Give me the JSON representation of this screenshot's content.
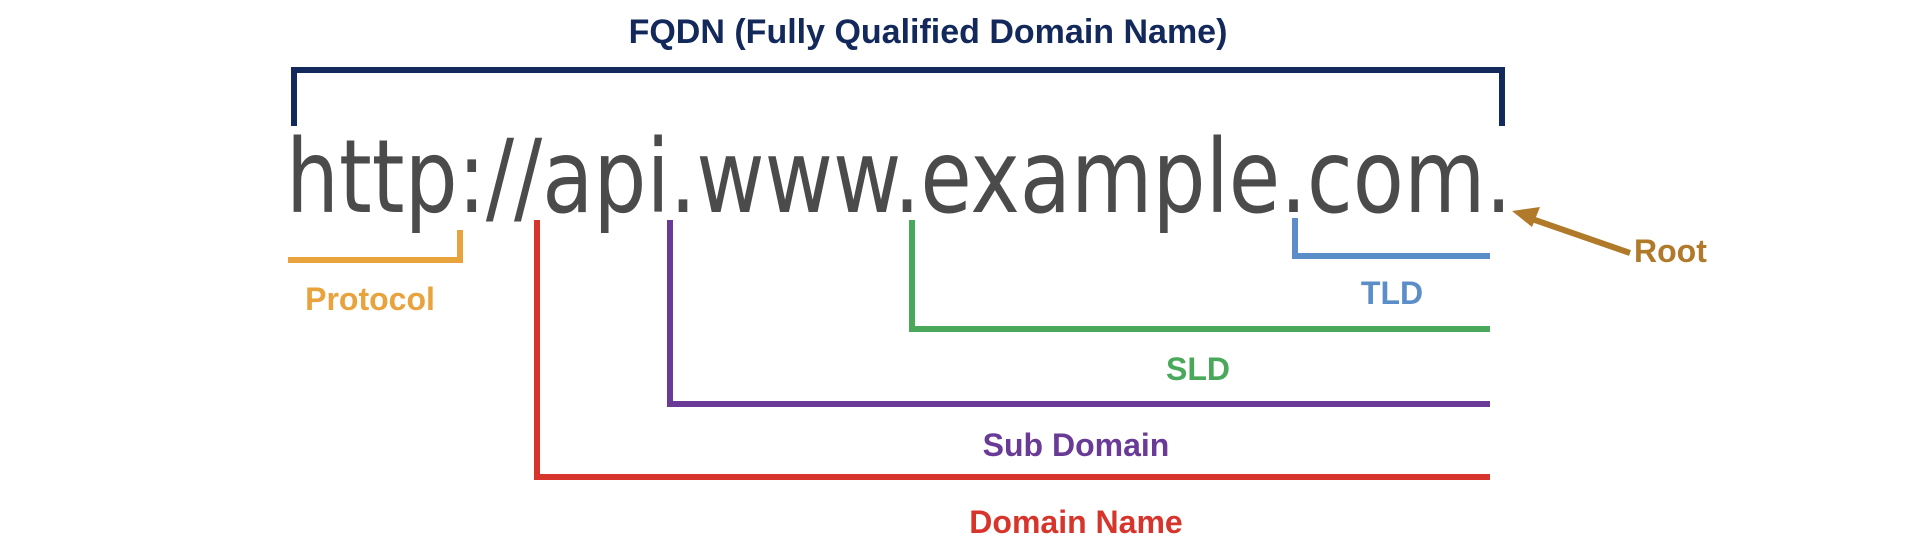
{
  "title": "FQDN (Fully Qualified Domain Name)",
  "url": {
    "protocol": "http:",
    "slashes": "//",
    "subdomain": "api.",
    "www": "www.",
    "sld": "example",
    "tld": ".com",
    "root": "."
  },
  "labels": {
    "protocol": "Protocol",
    "tld": "TLD",
    "sld": "SLD",
    "subdomain": "Sub Domain",
    "domain_name": "Domain Name",
    "root": "Root"
  },
  "colors": {
    "fqdn": "#13295b",
    "url_text": "#4b4b4b",
    "protocol": "#e8a33d",
    "tld": "#5b8dc9",
    "sld": "#4aa85a",
    "subdomain": "#6a3a97",
    "domain_name": "#d7342b",
    "root": "#b07a2a"
  }
}
